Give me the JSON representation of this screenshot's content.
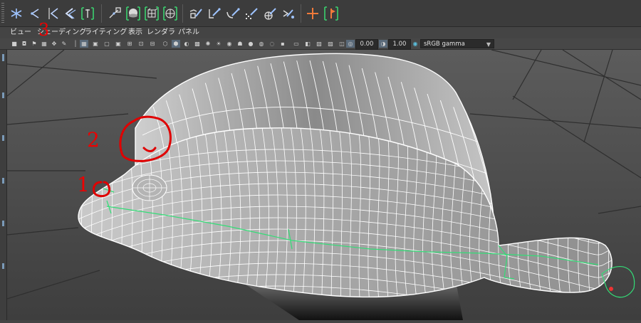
{
  "app": {
    "accent": "#5bc0de"
  },
  "shelf": {
    "tools": [
      {
        "name": "joint-tool-icon"
      },
      {
        "name": "insert-joint-icon"
      },
      {
        "name": "mirror-joint-icon"
      },
      {
        "name": "reroot-skeleton-icon"
      },
      {
        "name": "ik-handle-icon"
      },
      {
        "name": "bind-skin-icon"
      },
      {
        "name": "smooth-bind-icon"
      },
      {
        "name": "lattice-icon"
      },
      {
        "name": "cluster-icon"
      },
      {
        "name": "paint-weights-icon"
      },
      {
        "name": "skin-edit-icon"
      },
      {
        "name": "constraint-icon"
      },
      {
        "name": "parent-constraint-icon"
      },
      {
        "name": "aim-constraint-icon"
      },
      {
        "name": "orient-constraint-icon"
      },
      {
        "name": "pole-vector-icon"
      },
      {
        "name": "locator-icon"
      },
      {
        "name": "control-icon"
      }
    ]
  },
  "panel_menu": {
    "items": [
      {
        "label": "ビュー"
      },
      {
        "label": "シェーディング"
      },
      {
        "label": "ライティング"
      },
      {
        "label": "表示"
      },
      {
        "label": "レンダラ"
      },
      {
        "label": "パネル"
      }
    ]
  },
  "panel_toolbar": {
    "exposure_value": "0.00",
    "gamma_value": "1.00",
    "color_space": "sRGB gamma"
  },
  "annotations": {
    "mark_1": "1",
    "mark_2": "2",
    "mark_3": "3"
  },
  "colors": {
    "annotation": "#e00000",
    "wireframe": "#ffffff",
    "joint": "#33dd77"
  }
}
